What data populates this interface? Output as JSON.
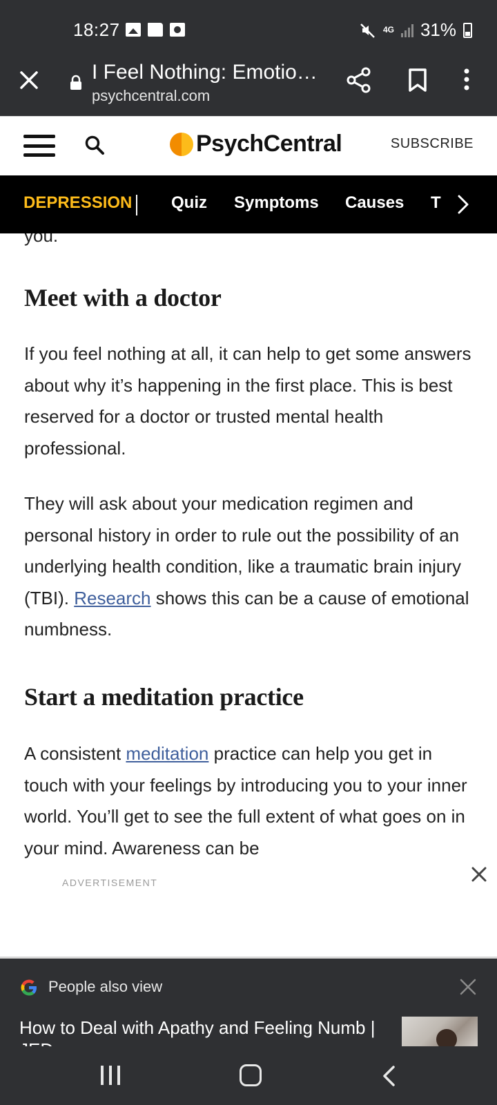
{
  "status_bar": {
    "time": "18:27",
    "network": "4G",
    "battery": "31%",
    "icons": [
      "gallery-icon",
      "folder-icon",
      "screen-record-icon",
      "mute-icon",
      "signal-icon",
      "battery-icon"
    ]
  },
  "browser": {
    "page_title": "I Feel Nothing: Emotio…",
    "url": "psychcentral.com",
    "icons": [
      "close-icon",
      "lock-icon",
      "share-icon",
      "bookmark-icon",
      "more-icon"
    ]
  },
  "site_header": {
    "logo_text": "PsychCentral",
    "subscribe_label": "SUBSCRIBE",
    "logo_colors": [
      "#f28c00",
      "#fdbb1a"
    ]
  },
  "category_nav": {
    "topic": "DEPRESSION",
    "items": [
      "Quiz",
      "Symptoms",
      "Causes",
      "T"
    ],
    "topic_color": "#fdbb1a"
  },
  "article": {
    "fragment": "you.",
    "sections": [
      {
        "heading": "Meet with a doctor",
        "paragraphs": [
          "If you feel nothing at all, it can help to get some answers about why it’s happening in the first place. This is best reserved for a doctor or trusted mental health professional."
        ]
      },
      {
        "p2_before": "They will ask about your medication regimen and personal history in order to rule out the possibility of an underlying health condition, like a traumatic brain injury (TBI). ",
        "p2_link": "Research",
        "p2_after": " shows this can be a cause of emotional numbness."
      },
      {
        "heading": "Start a meditation practice",
        "p3_before": "A consistent ",
        "p3_link": "meditation",
        "p3_after": " practice can help you get in touch with your feelings by introducing you to your inner world. You’ll get to see the full extent of what goes on in your mind. Awareness can be"
      }
    ],
    "link_color": "#3f5f9c"
  },
  "advertisement_label": "ADVERTISEMENT",
  "people_also_view": {
    "label": "People also view",
    "title": "How to Deal with Apathy and Feeling Numb | JED"
  }
}
